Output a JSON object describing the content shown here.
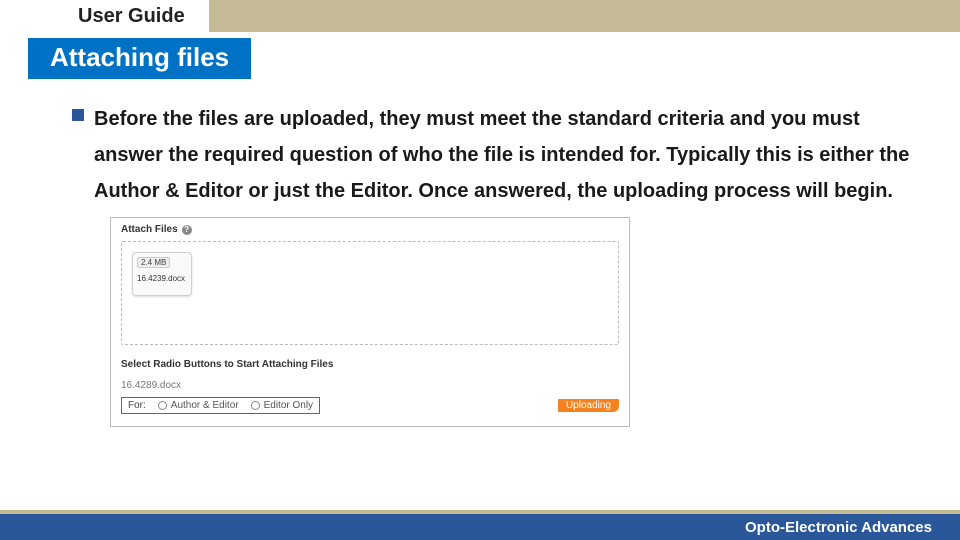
{
  "header": {
    "title": "User Guide"
  },
  "section": {
    "heading": "Attaching files"
  },
  "bullet": {
    "text": "Before the files are uploaded, they must meet the standard criteria and you must answer the required question of who the file is intended for. Typically this is either the Author & Editor or just the Editor. Once answered, the uploading process will begin."
  },
  "panel": {
    "attach_label": "Attach Files",
    "help_glyph": "?",
    "file_thumb": {
      "size": "2.4 MB",
      "name": "16.4239.docx"
    },
    "subheading": "Select Radio Buttons to Start Attaching Files",
    "file_listed": "16.4289.docx",
    "for_label": "For:",
    "option_author_editor": "Author & Editor",
    "option_editor_only": "Editor Only",
    "uploading_label": "Uploading"
  },
  "footer": {
    "brand": "Opto-Electronic Advances"
  }
}
